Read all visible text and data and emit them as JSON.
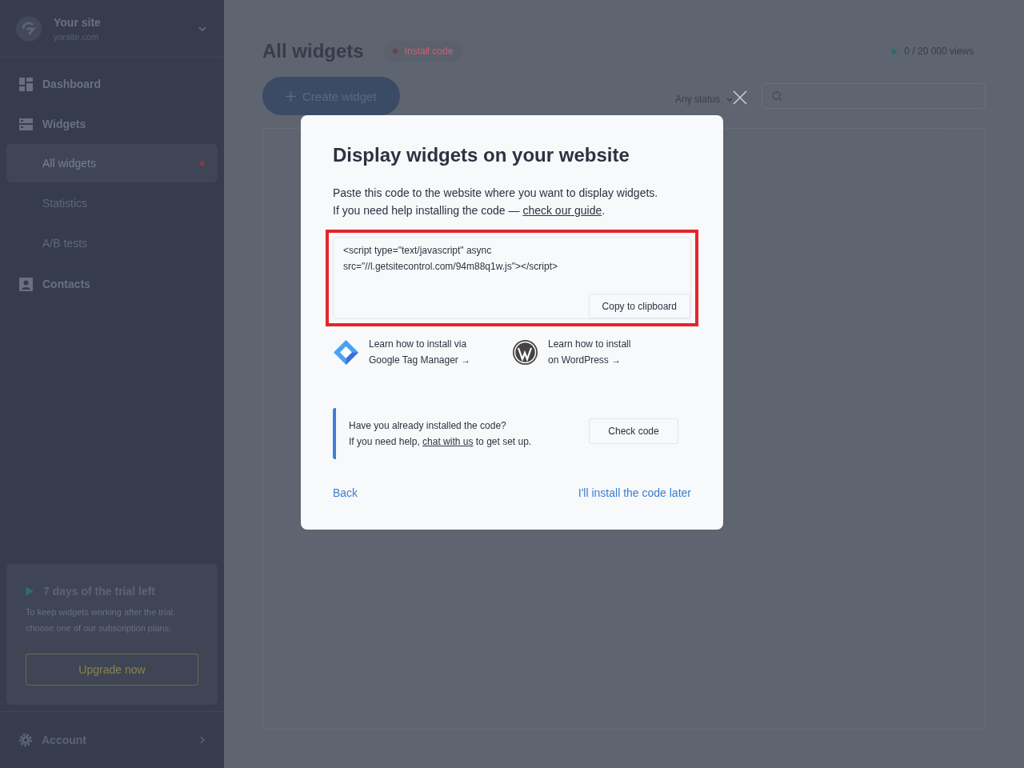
{
  "sidebar": {
    "site": {
      "name": "Your site",
      "domain": "yorsite.com"
    },
    "nav": [
      {
        "label": "Dashboard"
      },
      {
        "label": "Widgets",
        "children": [
          {
            "label": "All widgets",
            "selected": true,
            "alert": true
          },
          {
            "label": "Statistics",
            "selected": false,
            "alert": false
          },
          {
            "label": "A/B tests",
            "selected": false,
            "alert": false
          }
        ]
      },
      {
        "label": "Contacts"
      }
    ],
    "trial": {
      "title": "7 days of the trial left",
      "text": "To keep widgets working after the trial, choose one of our subscription plans.",
      "button": "Upgrade now"
    },
    "account": "Account"
  },
  "main": {
    "title": "All widgets",
    "badge": "Install code",
    "views": "0 / 20 000 views",
    "create": "Create widget",
    "filter": "Any status"
  },
  "modal": {
    "title": "Display widgets on your website",
    "intro": "Paste this code to the website where you want to display widgets.",
    "help": {
      "before": "If you need help installing the code — ",
      "link": "check our guide",
      "after": "."
    },
    "code": [
      "<script type=\"text/javascript\" async",
      "src=\"//l.getsitecontrol.com/94m88q1w.js\"></script>"
    ],
    "copy": "Copy to clipboard",
    "guides": [
      {
        "line1": "Learn how to install via",
        "line2": "Google Tag Manager →"
      },
      {
        "line1": "Learn how to install",
        "line2": "on WordPress →"
      }
    ],
    "notice": {
      "question": "Have you already installed the code?",
      "before": "If you need help, ",
      "link": "chat with us",
      "after": " to get set up.",
      "button": "Check code"
    },
    "back": "Back",
    "later": "I'll install the code later"
  }
}
